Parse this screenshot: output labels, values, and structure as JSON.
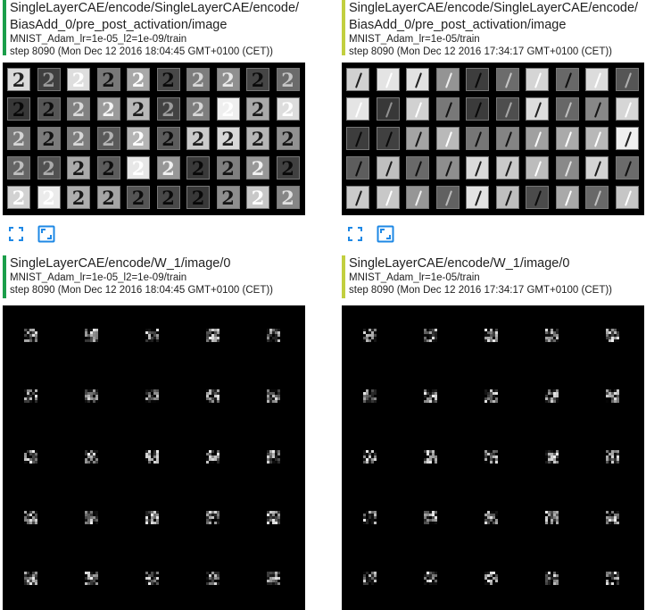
{
  "cards": [
    {
      "title": "SingleLayerCAE/encode/SingleLayerCAE/encode/BiasAdd_0/pre_post_activation/image",
      "title_line1": "SingleLayerCAE/encode/SingleLayerCAE/encode/",
      "title_line2": "BiasAdd_0/pre_post_activation/image",
      "run": "MNIST_Adam_lr=1e-05_l2=1e-09/train",
      "step": "step 8090 (Mon Dec 12 2016 18:04:45 GMT+0100 (CET))",
      "run_color": "#1b9e4a",
      "glyph": "2",
      "expand_icon": "fit-screen-icon",
      "actual_size_icon": "actual-size-icon"
    },
    {
      "title": "SingleLayerCAE/encode/SingleLayerCAE/encode/BiasAdd_0/pre_post_activation/image",
      "title_line1": "SingleLayerCAE/encode/SingleLayerCAE/encode/",
      "title_line2": "BiasAdd_0/pre_post_activation/image",
      "run": "MNIST_Adam_lr=1e-05/train",
      "step": "step 8090 (Mon Dec 12 2016 17:34:17 GMT+0100 (CET))",
      "run_color": "#c2cf3f",
      "glyph": "1",
      "expand_icon": "fit-screen-icon",
      "actual_size_icon": "actual-size-icon"
    },
    {
      "title": "SingleLayerCAE/encode/W_1/image/0",
      "run": "MNIST_Adam_lr=1e-05_l2=1e-09/train",
      "step": "step 8090 (Mon Dec 12 2016 18:04:45 GMT+0100 (CET))",
      "run_color": "#1b9e4a"
    },
    {
      "title": "SingleLayerCAE/encode/W_1/image/0",
      "run": "MNIST_Adam_lr=1e-05/train",
      "step": "step 8090 (Mon Dec 12 2016 17:34:17 GMT+0100 (CET))",
      "run_color": "#c2cf3f"
    }
  ],
  "colors": {
    "icon_blue": "#1e88e5"
  }
}
